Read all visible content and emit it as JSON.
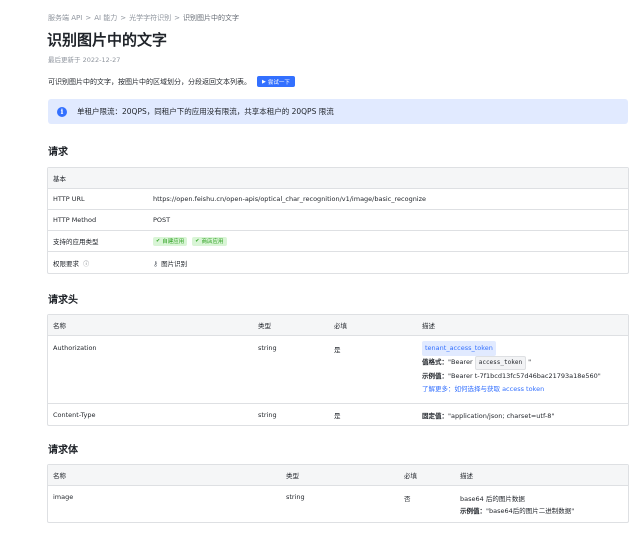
{
  "breadcrumb": [
    "服务端 API",
    "AI 能力",
    "光学字符识别",
    "识别图片中的文字"
  ],
  "breadcrumb_separator": ">",
  "page": {
    "title": "识别图片中的文字",
    "updated": "最后更新于 2022-12-27",
    "description": "可识别图片中的文字，按图片中的区域划分，分段返回文本列表。",
    "try_button": "尝试一下"
  },
  "info": {
    "icon": "info-icon",
    "text": "单租户限流：20QPS，同租户下的应用没有限流，共享本租户的 20QPS 限流"
  },
  "request": {
    "heading": "请求",
    "basic_label": "基本",
    "rows": [
      {
        "label": "HTTP URL",
        "value": "https://open.feishu.cn/open-apis/optical_char_recognition/v1/image/basic_recognize"
      },
      {
        "label": "HTTP Method",
        "value": "POST"
      },
      {
        "label": "支持的应用类型",
        "badges": [
          "自建应用",
          "商店应用"
        ]
      },
      {
        "label": "权限要求",
        "value": "图片识别"
      }
    ]
  },
  "headers": {
    "heading": "请求头",
    "columns": [
      "名称",
      "类型",
      "必填",
      "描述"
    ],
    "rows": [
      {
        "name": "Authorization",
        "type": "string",
        "required": "是",
        "tag": "tenant_access_token",
        "format_label": "值格式：",
        "format_prefix": "\"Bearer",
        "format_code": "access_token",
        "format_suffix": "\"",
        "example_label": "示例值：",
        "example_value": "\"Bearer t-7f1bcd13fc57d46bac21793a18e560\"",
        "more_label": "了解更多：",
        "more_link": "如何选择与获取 access token"
      },
      {
        "name": "Content-Type",
        "type": "string",
        "required": "是",
        "fixed_label": "固定值：",
        "fixed_value": "\"application/json; charset=utf-8\""
      }
    ]
  },
  "body": {
    "heading": "请求体",
    "columns": [
      "名称",
      "类型",
      "必填",
      "描述"
    ],
    "rows": [
      {
        "name": "image",
        "type": "string",
        "required": "否",
        "desc": "base64 后的图片数据",
        "example_label": "示例值：",
        "example_value": "\"base64后的图片二进制数据\""
      }
    ]
  }
}
